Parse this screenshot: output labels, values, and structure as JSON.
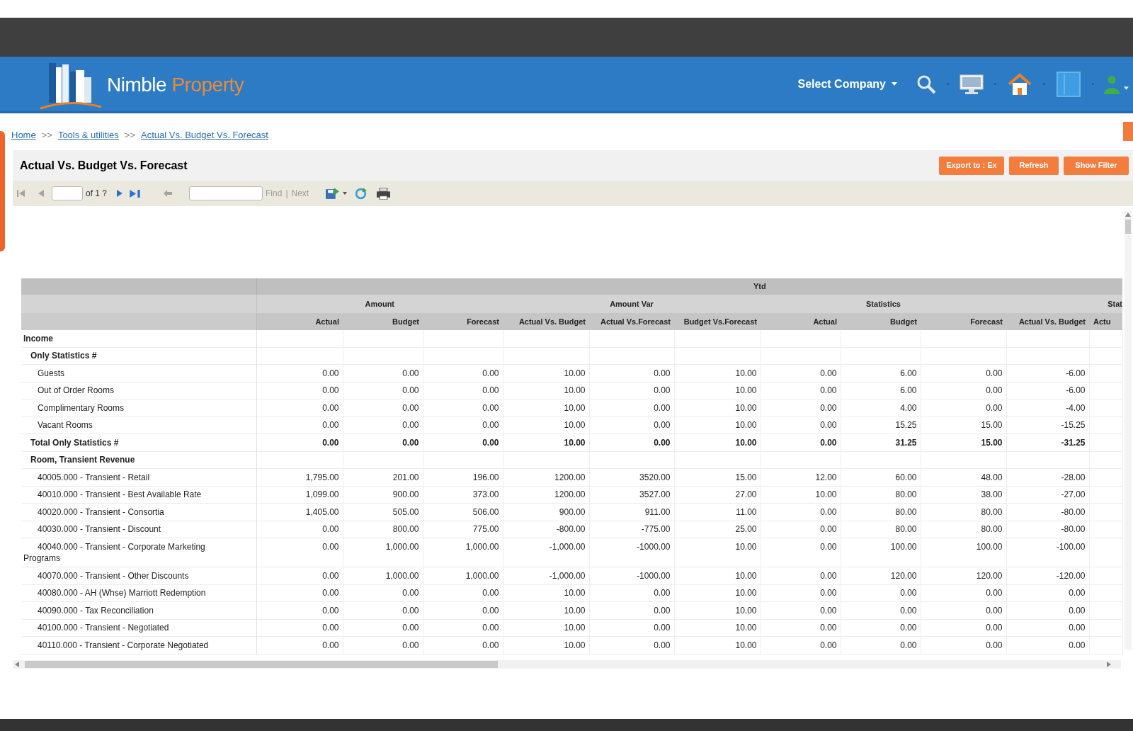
{
  "header": {
    "logo": {
      "first_word": "Nimble",
      "second_word": "Property"
    },
    "company_select": {
      "label": "Select Company"
    }
  },
  "breadcrumb": [
    {
      "kind": "link",
      "label": "Home"
    },
    {
      "kind": "separator",
      "label": ">>"
    },
    {
      "kind": "link",
      "label": "Tools & utilities"
    },
    {
      "kind": "separator",
      "label": ">>"
    },
    {
      "kind": "link",
      "label": "Actual Vs. Budget Vs. Forecast"
    }
  ],
  "report": {
    "title": "Actual Vs. Budget Vs. Forecast",
    "buttons": [
      {
        "kind": "export",
        "label": "Export to : Ex"
      },
      {
        "kind": "refresh",
        "label": "Refresh"
      },
      {
        "kind": "filter",
        "label": "Show Filter"
      }
    ],
    "toolbar": {
      "page_count": "of 1 ?",
      "find": "Find",
      "find_separator": "|",
      "next": "Next"
    },
    "table": {
      "top_header": "Ytd",
      "groups": [
        {
          "label": "Amount",
          "columns": [
            "Actual",
            "Budget",
            "Forecast"
          ]
        },
        {
          "label": "Amount Var",
          "columns": [
            "Actual Vs. Budget",
            "Actual Vs.Forecast",
            "Budget Vs.Forecast"
          ]
        },
        {
          "label": "Statistics",
          "columns": [
            "Actual",
            "Budget",
            "Forecast"
          ]
        },
        {
          "label": "Stat",
          "columns": [
            "Actual Vs. Budget",
            "Actu"
          ]
        }
      ],
      "rows": [
        {
          "kind": "group",
          "label": "Income",
          "children": [
            {
              "kind": "group",
              "label": "Only Statistics #",
              "children": [
                {
                  "kind": "item",
                  "label": "Guests",
                  "values": [
                    "0.00",
                    "0.00",
                    "0.00",
                    "10.00",
                    "0.00",
                    "10.00",
                    "0.00",
                    "6.00",
                    "0.00",
                    "-6.00"
                  ]
                },
                {
                  "kind": "item",
                  "label": "Out of Order Rooms",
                  "values": [
                    "0.00",
                    "0.00",
                    "0.00",
                    "10.00",
                    "0.00",
                    "10.00",
                    "0.00",
                    "6.00",
                    "0.00",
                    "-6.00"
                  ]
                },
                {
                  "kind": "item",
                  "label": "Complimentary Rooms",
                  "values": [
                    "0.00",
                    "0.00",
                    "0.00",
                    "10.00",
                    "0.00",
                    "10.00",
                    "0.00",
                    "4.00",
                    "0.00",
                    "-4.00"
                  ]
                },
                {
                  "kind": "item",
                  "label": "Vacant Rooms",
                  "values": [
                    "0.00",
                    "0.00",
                    "0.00",
                    "10.00",
                    "0.00",
                    "10.00",
                    "0.00",
                    "15.25",
                    "15.00",
                    "-15.25"
                  ]
                }
              ]
            },
            {
              "kind": "total",
              "label": "Total Only Statistics #",
              "values": [
                "0.00",
                "0.00",
                "0.00",
                "10.00",
                "0.00",
                "10.00",
                "0.00",
                "31.25",
                "15.00",
                "-31.25"
              ]
            },
            {
              "kind": "group",
              "label": "Room, Transient Revenue",
              "children": [
                {
                  "kind": "item",
                  "label": "40005.000 - Transient - Retail",
                  "values": [
                    "1,795.00",
                    "201.00",
                    "196.00",
                    "1200.00",
                    "3520.00",
                    "15.00",
                    "12.00",
                    "60.00",
                    "48.00",
                    "-28.00"
                  ]
                },
                {
                  "kind": "item",
                  "label": "40010.000 - Transient - Best Available Rate",
                  "values": [
                    "1,099.00",
                    "900.00",
                    "373.00",
                    "1200.00",
                    "3527.00",
                    "27.00",
                    "10.00",
                    "80.00",
                    "38.00",
                    "-27.00"
                  ]
                },
                {
                  "kind": "item",
                  "label": "40020.000 - Transient - Consortia",
                  "values": [
                    "1,405.00",
                    "505.00",
                    "506.00",
                    "900.00",
                    "911.00",
                    "11.00",
                    "0.00",
                    "80.00",
                    "80.00",
                    "-80.00"
                  ]
                },
                {
                  "kind": "item",
                  "label": "40030.000 - Transient - Discount",
                  "values": [
                    "0.00",
                    "800.00",
                    "775.00",
                    "-800.00",
                    "-775.00",
                    "25.00",
                    "0.00",
                    "80.00",
                    "80.00",
                    "-80.00"
                  ]
                },
                {
                  "kind": "item",
                  "label": "40040.000 - Transient - Corporate Marketing Programs",
                  "values": [
                    "0.00",
                    "1,000.00",
                    "1,000.00",
                    "-1,000.00",
                    "-1000.00",
                    "10.00",
                    "0.00",
                    "100.00",
                    "100.00",
                    "-100.00"
                  ]
                },
                {
                  "kind": "item",
                  "label": "40070.000 - Transient - Other Discounts",
                  "values": [
                    "0.00",
                    "1,000.00",
                    "1,000.00",
                    "-1,000.00",
                    "-1000.00",
                    "10.00",
                    "0.00",
                    "120.00",
                    "120.00",
                    "-120.00"
                  ]
                },
                {
                  "kind": "item",
                  "label": "40080.000 - AH (Whse) Marriott Redemption",
                  "values": [
                    "0.00",
                    "0.00",
                    "0.00",
                    "10.00",
                    "0.00",
                    "10.00",
                    "0.00",
                    "0.00",
                    "0.00",
                    "0.00"
                  ]
                },
                {
                  "kind": "item",
                  "label": "40090.000 - Tax Reconciliation",
                  "values": [
                    "0.00",
                    "0.00",
                    "0.00",
                    "10.00",
                    "0.00",
                    "10.00",
                    "0.00",
                    "0.00",
                    "0.00",
                    "0.00"
                  ]
                },
                {
                  "kind": "item",
                  "label": "40100.000 - Transient - Negotiated",
                  "values": [
                    "0.00",
                    "0.00",
                    "0.00",
                    "10.00",
                    "0.00",
                    "10.00",
                    "0.00",
                    "0.00",
                    "0.00",
                    "0.00"
                  ]
                },
                {
                  "kind": "item",
                  "label": "40110.000 - Transient - Corporate Negotiated",
                  "values": [
                    "0.00",
                    "0.00",
                    "0.00",
                    "10.00",
                    "0.00",
                    "10.00",
                    "0.00",
                    "0.00",
                    "0.00",
                    "0.00"
                  ]
                }
              ]
            }
          ]
        }
      ]
    }
  }
}
